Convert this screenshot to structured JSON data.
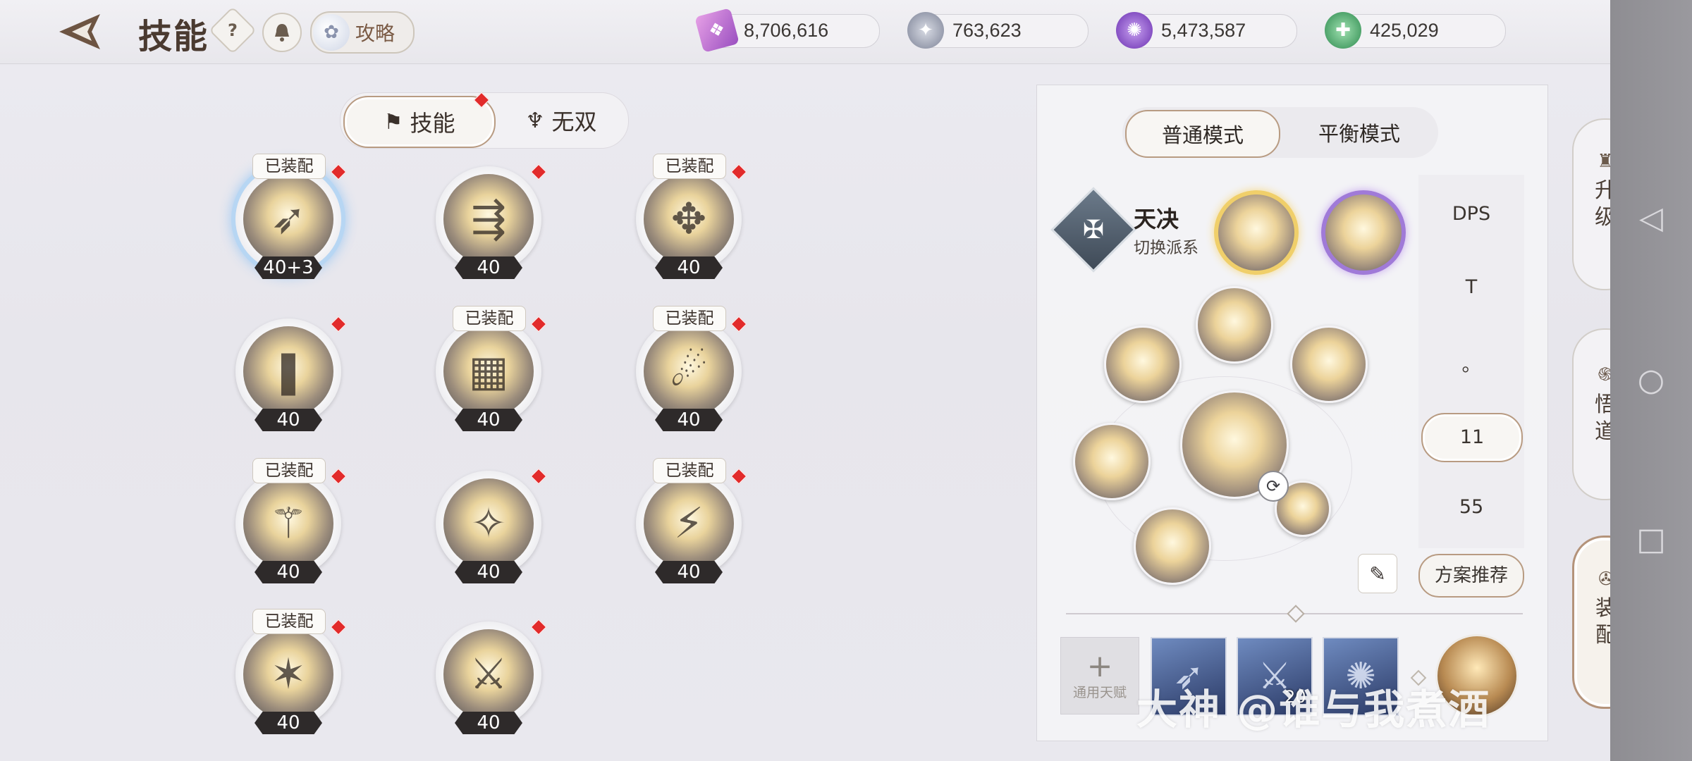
{
  "header": {
    "title": "技能",
    "help_label": "?",
    "guide_label": "攻略"
  },
  "currencies": [
    {
      "icon": "purple-ticket-icon",
      "value": "8,706,616",
      "color": "#c86bd6"
    },
    {
      "icon": "silver-coin-icon",
      "value": "763,623",
      "color": "#8d93a6"
    },
    {
      "icon": "purple-orb-icon",
      "value": "5,473,587",
      "color": "#8d4ed0"
    },
    {
      "icon": "green-jade-icon",
      "value": "425,029",
      "color": "#3f9c5e"
    }
  ],
  "tabs": [
    {
      "label": "技能",
      "icon": "flag-icon",
      "active": true
    },
    {
      "label": "无双",
      "icon": "mask-icon",
      "active": false
    }
  ],
  "skills": [
    {
      "level": "40+3",
      "equipped": true,
      "selected": true
    },
    {
      "level": "40",
      "equipped": false
    },
    {
      "level": "40",
      "equipped": true
    },
    {
      "level": "40",
      "equipped": false
    },
    {
      "level": "40",
      "equipped": true
    },
    {
      "level": "40",
      "equipped": true
    },
    {
      "level": "40",
      "equipped": true
    },
    {
      "level": "40",
      "equipped": false
    },
    {
      "level": "40",
      "equipped": true
    },
    {
      "level": "40",
      "equipped": true
    },
    {
      "level": "40",
      "equipped": false
    }
  ],
  "equipped_label": "已装配",
  "panel": {
    "modes": [
      "普通模式",
      "平衡模式"
    ],
    "school_name": "天决",
    "school_switch": "切换派系",
    "side_values": [
      "DPS",
      "T",
      "。",
      "11",
      "55"
    ],
    "recommend_label": "方案推荐",
    "talent_label": "通用天赋",
    "talent_num": "20"
  },
  "side_nav": [
    "升级",
    "悟道",
    "装配"
  ],
  "watermark": "大神 @谁与我煮酒"
}
